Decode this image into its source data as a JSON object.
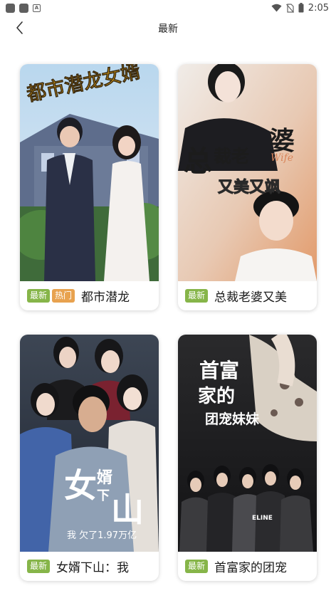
{
  "status_bar": {
    "time": "2:05",
    "icons": [
      "app-icon",
      "app-icon",
      "a-icon",
      "wifi-icon",
      "no-sim-icon",
      "battery-icon"
    ]
  },
  "header": {
    "title": "最新",
    "back_icon": "chevron-left-icon"
  },
  "colors": {
    "badge_new": "#86b549",
    "badge_hot": "#e8a24f"
  },
  "dramas": [
    {
      "title": "都市潜龙",
      "badges": [
        "最新",
        "热门"
      ],
      "poster_title": "都市潜龙女婿"
    },
    {
      "title": "总裁老婆又美",
      "badges": [
        "最新"
      ],
      "poster_title": "总裁老婆",
      "poster_subtitle": "又美又飒",
      "poster_english": "Wife"
    },
    {
      "title": "女婿下山：我",
      "badges": [
        "最新"
      ],
      "poster_title": "女婿下山",
      "poster_subtitle": "我 欠了1.97万亿"
    },
    {
      "title": "首富家的团宠",
      "badges": [
        "最新"
      ],
      "poster_title": "首富家的团宠妹妹",
      "poster_logo": "ELINE"
    }
  ]
}
